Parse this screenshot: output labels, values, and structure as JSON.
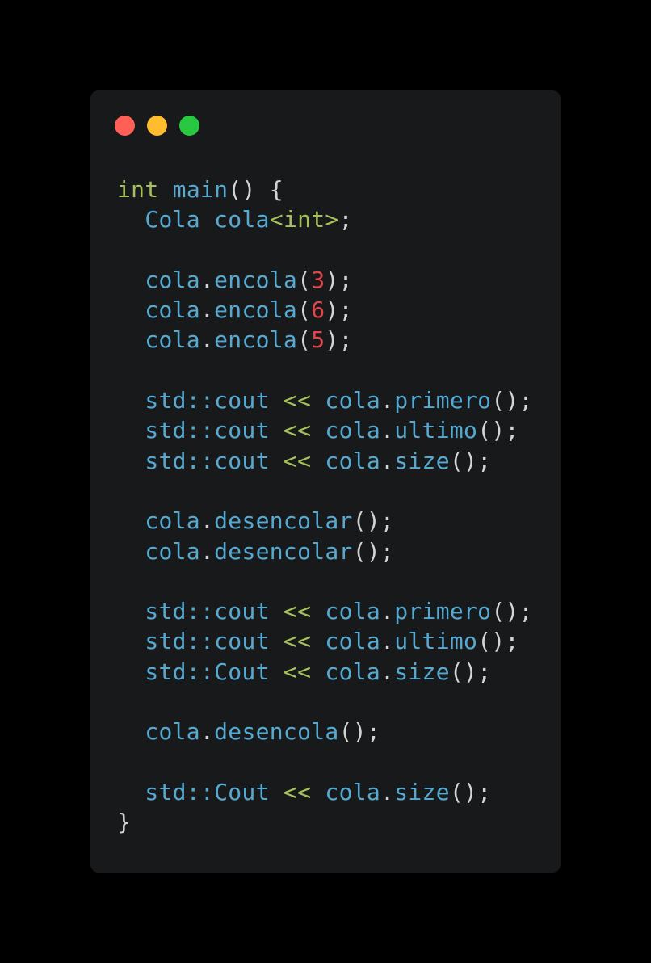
{
  "window": {
    "dots": [
      {
        "name": "close",
        "color": "#ff5f57"
      },
      {
        "name": "minimize",
        "color": "#febc2e"
      },
      {
        "name": "maximize",
        "color": "#28c840"
      }
    ]
  },
  "code_lines": [
    [
      {
        "t": "int",
        "c": "kw"
      },
      {
        "t": " ",
        "c": "punc"
      },
      {
        "t": "main",
        "c": "id"
      },
      {
        "t": "() {",
        "c": "punc"
      }
    ],
    [
      {
        "t": "  ",
        "c": "punc"
      },
      {
        "t": "Cola",
        "c": "id"
      },
      {
        "t": " ",
        "c": "punc"
      },
      {
        "t": "cola",
        "c": "id"
      },
      {
        "t": "<int>",
        "c": "kw"
      },
      {
        "t": ";",
        "c": "punc"
      }
    ],
    [],
    [
      {
        "t": "  ",
        "c": "punc"
      },
      {
        "t": "cola",
        "c": "id"
      },
      {
        "t": ".",
        "c": "punc"
      },
      {
        "t": "encola",
        "c": "id"
      },
      {
        "t": "(",
        "c": "punc"
      },
      {
        "t": "3",
        "c": "num"
      },
      {
        "t": ");",
        "c": "punc"
      }
    ],
    [
      {
        "t": "  ",
        "c": "punc"
      },
      {
        "t": "cola",
        "c": "id"
      },
      {
        "t": ".",
        "c": "punc"
      },
      {
        "t": "encola",
        "c": "id"
      },
      {
        "t": "(",
        "c": "punc"
      },
      {
        "t": "6",
        "c": "num"
      },
      {
        "t": ");",
        "c": "punc"
      }
    ],
    [
      {
        "t": "  ",
        "c": "punc"
      },
      {
        "t": "cola",
        "c": "id"
      },
      {
        "t": ".",
        "c": "punc"
      },
      {
        "t": "encola",
        "c": "id"
      },
      {
        "t": "(",
        "c": "punc"
      },
      {
        "t": "5",
        "c": "num"
      },
      {
        "t": ");",
        "c": "punc"
      }
    ],
    [],
    [
      {
        "t": "  ",
        "c": "punc"
      },
      {
        "t": "std::cout",
        "c": "id"
      },
      {
        "t": " ",
        "c": "punc"
      },
      {
        "t": "<<",
        "c": "op"
      },
      {
        "t": " ",
        "c": "punc"
      },
      {
        "t": "cola",
        "c": "id"
      },
      {
        "t": ".",
        "c": "punc"
      },
      {
        "t": "primero",
        "c": "id"
      },
      {
        "t": "();",
        "c": "punc"
      }
    ],
    [
      {
        "t": "  ",
        "c": "punc"
      },
      {
        "t": "std::cout",
        "c": "id"
      },
      {
        "t": " ",
        "c": "punc"
      },
      {
        "t": "<<",
        "c": "op"
      },
      {
        "t": " ",
        "c": "punc"
      },
      {
        "t": "cola",
        "c": "id"
      },
      {
        "t": ".",
        "c": "punc"
      },
      {
        "t": "ultimo",
        "c": "id"
      },
      {
        "t": "();",
        "c": "punc"
      }
    ],
    [
      {
        "t": "  ",
        "c": "punc"
      },
      {
        "t": "std::cout",
        "c": "id"
      },
      {
        "t": " ",
        "c": "punc"
      },
      {
        "t": "<<",
        "c": "op"
      },
      {
        "t": " ",
        "c": "punc"
      },
      {
        "t": "cola",
        "c": "id"
      },
      {
        "t": ".",
        "c": "punc"
      },
      {
        "t": "size",
        "c": "id"
      },
      {
        "t": "();",
        "c": "punc"
      }
    ],
    [],
    [
      {
        "t": "  ",
        "c": "punc"
      },
      {
        "t": "cola",
        "c": "id"
      },
      {
        "t": ".",
        "c": "punc"
      },
      {
        "t": "desencolar",
        "c": "id"
      },
      {
        "t": "();",
        "c": "punc"
      }
    ],
    [
      {
        "t": "  ",
        "c": "punc"
      },
      {
        "t": "cola",
        "c": "id"
      },
      {
        "t": ".",
        "c": "punc"
      },
      {
        "t": "desencolar",
        "c": "id"
      },
      {
        "t": "();",
        "c": "punc"
      }
    ],
    [],
    [
      {
        "t": "  ",
        "c": "punc"
      },
      {
        "t": "std::cout",
        "c": "id"
      },
      {
        "t": " ",
        "c": "punc"
      },
      {
        "t": "<<",
        "c": "op"
      },
      {
        "t": " ",
        "c": "punc"
      },
      {
        "t": "cola",
        "c": "id"
      },
      {
        "t": ".",
        "c": "punc"
      },
      {
        "t": "primero",
        "c": "id"
      },
      {
        "t": "();",
        "c": "punc"
      }
    ],
    [
      {
        "t": "  ",
        "c": "punc"
      },
      {
        "t": "std::cout",
        "c": "id"
      },
      {
        "t": " ",
        "c": "punc"
      },
      {
        "t": "<<",
        "c": "op"
      },
      {
        "t": " ",
        "c": "punc"
      },
      {
        "t": "cola",
        "c": "id"
      },
      {
        "t": ".",
        "c": "punc"
      },
      {
        "t": "ultimo",
        "c": "id"
      },
      {
        "t": "();",
        "c": "punc"
      }
    ],
    [
      {
        "t": "  ",
        "c": "punc"
      },
      {
        "t": "std::Cout",
        "c": "id"
      },
      {
        "t": " ",
        "c": "punc"
      },
      {
        "t": "<<",
        "c": "op"
      },
      {
        "t": " ",
        "c": "punc"
      },
      {
        "t": "cola",
        "c": "id"
      },
      {
        "t": ".",
        "c": "punc"
      },
      {
        "t": "size",
        "c": "id"
      },
      {
        "t": "();",
        "c": "punc"
      }
    ],
    [],
    [
      {
        "t": "  ",
        "c": "punc"
      },
      {
        "t": "cola",
        "c": "id"
      },
      {
        "t": ".",
        "c": "punc"
      },
      {
        "t": "desencola",
        "c": "id"
      },
      {
        "t": "();",
        "c": "punc"
      }
    ],
    [],
    [
      {
        "t": "  ",
        "c": "punc"
      },
      {
        "t": "std::Cout",
        "c": "id"
      },
      {
        "t": " ",
        "c": "punc"
      },
      {
        "t": "<<",
        "c": "op"
      },
      {
        "t": " ",
        "c": "punc"
      },
      {
        "t": "cola",
        "c": "id"
      },
      {
        "t": ".",
        "c": "punc"
      },
      {
        "t": "size",
        "c": "id"
      },
      {
        "t": "();",
        "c": "punc"
      }
    ],
    [
      {
        "t": "}",
        "c": "punc"
      }
    ]
  ]
}
